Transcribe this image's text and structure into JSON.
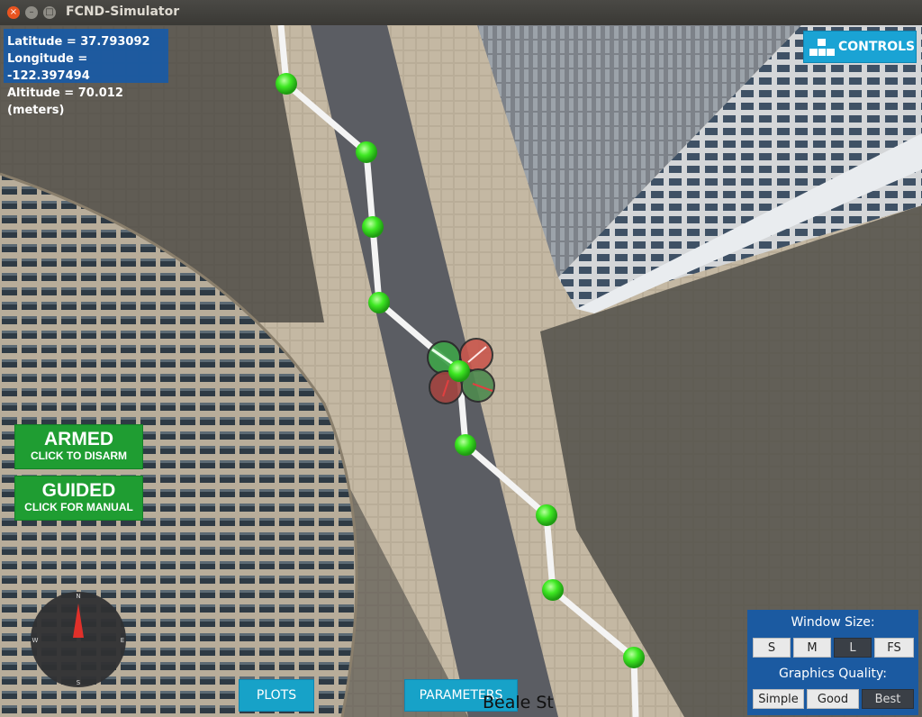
{
  "window": {
    "title": "FCND-Simulator"
  },
  "telemetry": {
    "latitude": "Latitude = 37.793092",
    "longitude": "Longitude = -122.397494",
    "altitude": "Altitude = 70.012 (meters)"
  },
  "controls_button": {
    "label": "CONTROLS"
  },
  "armed_button": {
    "title": "ARMED",
    "subtitle": "CLICK TO DISARM"
  },
  "guided_button": {
    "title": "GUIDED",
    "subtitle": "CLICK FOR MANUAL"
  },
  "bottom_buttons": {
    "plots": "PLOTS",
    "parameters": "PARAMETERS"
  },
  "street_label": "Beale St",
  "compass": {
    "n": "N",
    "s": "S",
    "e": "E",
    "w": "W"
  },
  "window_size": {
    "title": "Window Size:",
    "options": [
      "S",
      "M",
      "L",
      "FS"
    ],
    "selected": "L"
  },
  "graphics_quality": {
    "title": "Graphics Quality:",
    "options": [
      "Simple",
      "Good",
      "Best"
    ],
    "selected": "Best"
  },
  "colors": {
    "panel_blue": "#1a5fa8",
    "button_cyan": "#17a2c8",
    "armed_green": "#1f9d32",
    "waypoint_green": "#3ee823"
  }
}
